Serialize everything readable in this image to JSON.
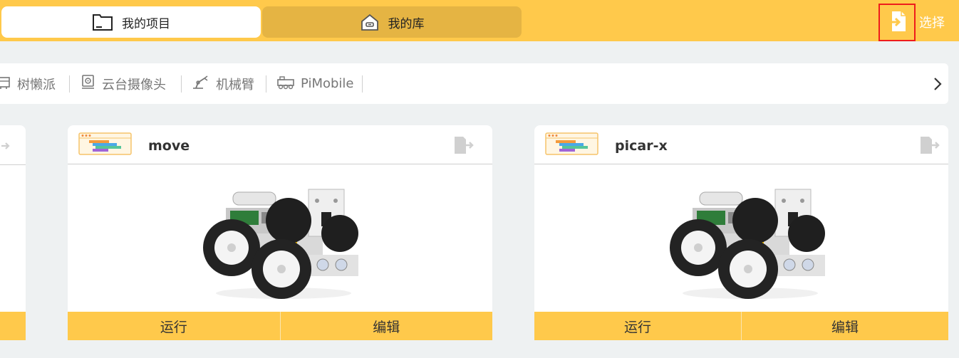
{
  "tabs": [
    {
      "label": "我的项目",
      "icon": "folder-icon",
      "active": true
    },
    {
      "label": "我的库",
      "icon": "home-icon",
      "active": false
    }
  ],
  "toolbar": {
    "select_label": "选择",
    "select_icon": "export-file-icon",
    "highlight_color": "#ee1c1c"
  },
  "categories": [
    {
      "label": "树懒派",
      "icon": "board-icon"
    },
    {
      "label": "云台摄像头",
      "icon": "camera-icon"
    },
    {
      "label": "机械臂",
      "icon": "robot-arm-icon"
    },
    {
      "label": "PiMobile",
      "icon": "vehicle-icon"
    }
  ],
  "projects": [
    {
      "title": "move",
      "image": "robot-car-image",
      "run_label": "运行",
      "edit_label": "编辑"
    },
    {
      "title": "picar-x",
      "image": "robot-car-image",
      "run_label": "运行",
      "edit_label": "编辑"
    }
  ],
  "colors": {
    "accent": "#ffc94b",
    "inactive_tab": "#e5b443",
    "background": "#eef1f2"
  }
}
